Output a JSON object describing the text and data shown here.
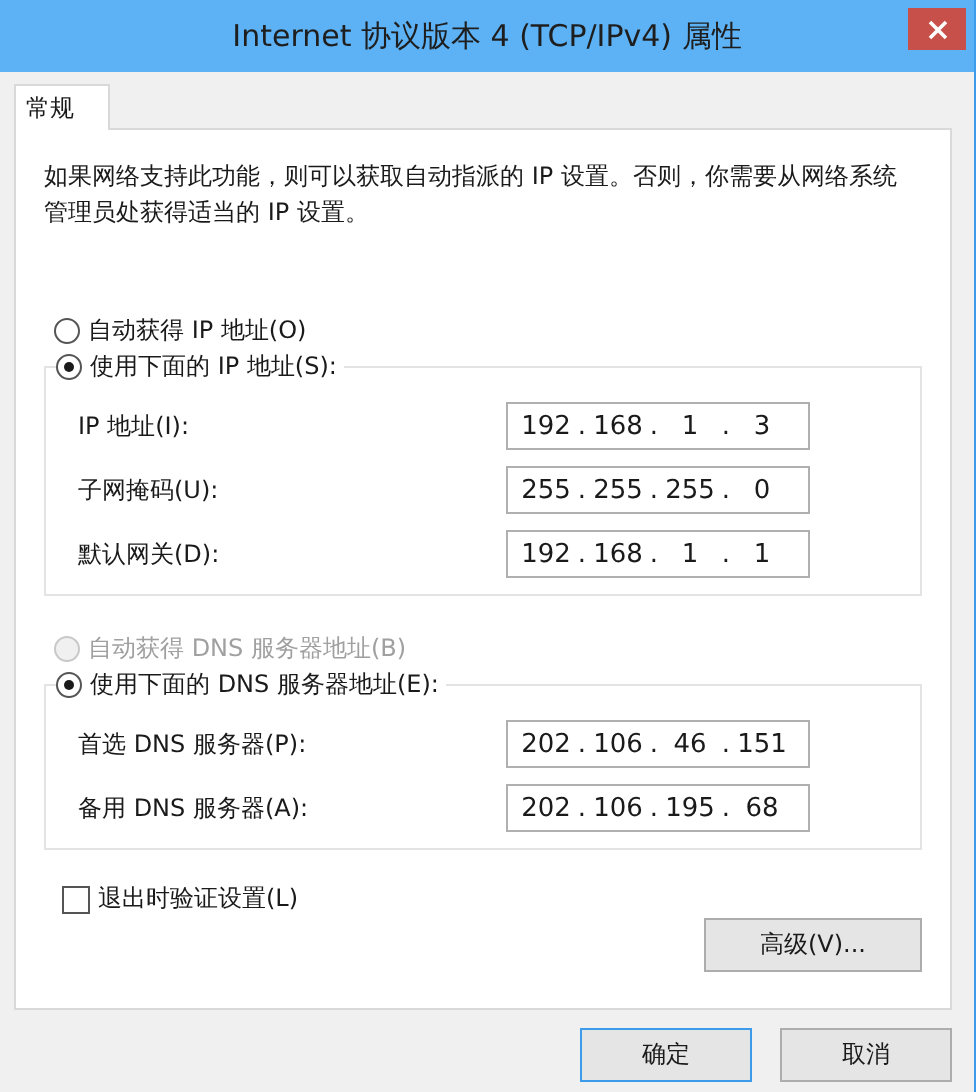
{
  "window": {
    "title": "Internet 协议版本 4 (TCP/IPv4) 属性"
  },
  "tabs": [
    {
      "label": "常规",
      "selected": true
    }
  ],
  "description": "如果网络支持此功能，则可以获取自动指派的 IP 设置。否则，你需要从网络系统管理员处获得适当的 IP 设置。",
  "sections": [
    {
      "options": [
        {
          "label": "自动获得 IP 地址(O)",
          "selected": false,
          "disabled": false
        },
        {
          "label": "使用下面的 IP 地址(S):",
          "selected": true,
          "disabled": false
        }
      ],
      "fields": [
        {
          "label": "IP 地址(I):",
          "value": "192 . 168 . 1 . 3"
        },
        {
          "label": "子网掩码(U):",
          "value": "255 . 255 . 255 . 0"
        },
        {
          "label": "默认网关(D):",
          "value": "192 . 168 . 1 . 1"
        }
      ]
    },
    {
      "options": [
        {
          "label": "自动获得 DNS 服务器地址(B)",
          "selected": false,
          "disabled": true
        },
        {
          "label": "使用下面的 DNS 服务器地址(E):",
          "selected": true,
          "disabled": false
        }
      ],
      "fields": [
        {
          "label": "首选 DNS 服务器(P):",
          "value": "202 . 106 . 46 . 151"
        },
        {
          "label": "备用 DNS 服务器(A):",
          "value": "202 . 106 . 195 . 68"
        }
      ]
    }
  ],
  "validate_on_exit": {
    "label": "退出时验证设置(L)",
    "checked": false
  },
  "advanced_button": "高级(V)...",
  "buttons": [
    "确定",
    "取消"
  ]
}
